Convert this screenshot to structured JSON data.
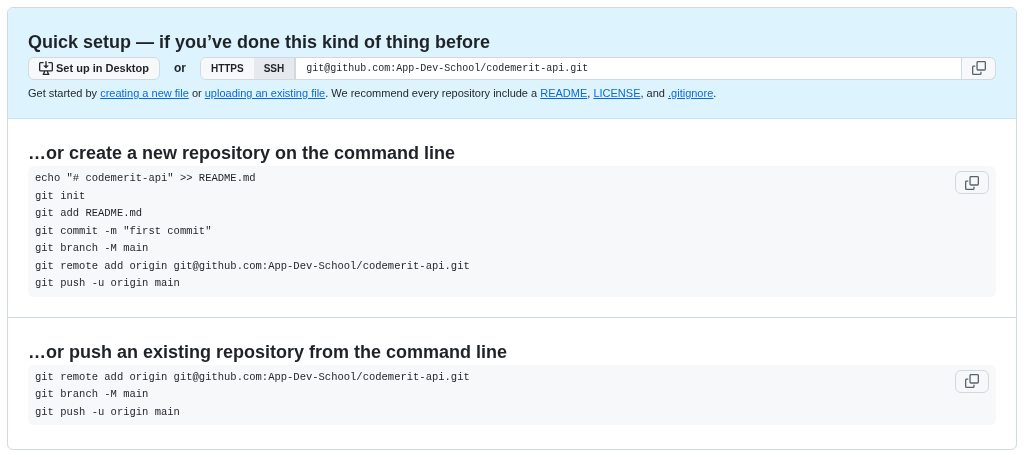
{
  "quick_setup": {
    "title": "Quick setup — if you’ve done this kind of thing before",
    "desktop_button": "Set up in Desktop",
    "or_label": "or",
    "protocols": [
      {
        "label": "HTTPS",
        "selected": false
      },
      {
        "label": "SSH",
        "selected": true
      }
    ],
    "clone_url": "git@github.com:App-Dev-School/codemerit-api.git",
    "hint": [
      {
        "text": "Get started by "
      },
      {
        "text": "creating a new file",
        "link": true
      },
      {
        "text": " or "
      },
      {
        "text": "uploading an existing file",
        "link": true
      },
      {
        "text": ". We recommend every repository include a "
      },
      {
        "text": "README",
        "link": true
      },
      {
        "text": ", "
      },
      {
        "text": "LICENSE",
        "link": true
      },
      {
        "text": ", and "
      },
      {
        "text": ".gitignore",
        "link": true
      },
      {
        "text": "."
      }
    ]
  },
  "sections": [
    {
      "title": "…or create a new repository on the command line",
      "lines": [
        "echo \"# codemerit-api\" >> README.md",
        "git init",
        "git add README.md",
        "git commit -m \"first commit\"",
        "git branch -M main",
        "git remote add origin git@github.com:App-Dev-School/codemerit-api.git",
        "git push -u origin main"
      ]
    },
    {
      "title": "…or push an existing repository from the command line",
      "lines": [
        "git remote add origin git@github.com:App-Dev-School/codemerit-api.git",
        "git branch -M main",
        "git push -u origin main"
      ]
    }
  ]
}
